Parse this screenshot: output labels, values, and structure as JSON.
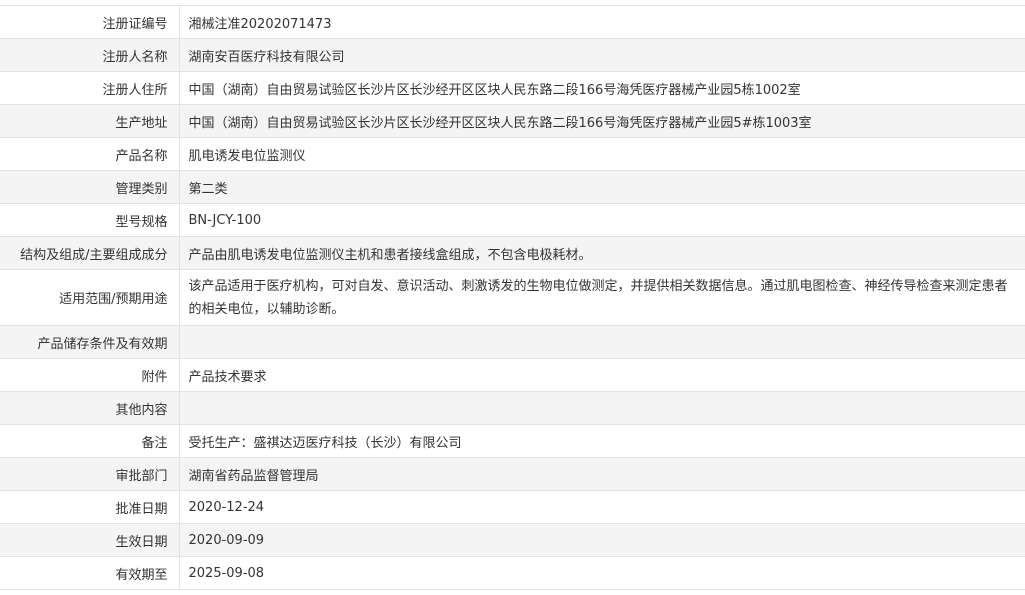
{
  "rows": [
    {
      "label": "注册证编号",
      "value": "湘械注准20202071473"
    },
    {
      "label": "注册人名称",
      "value": "湖南安百医疗科技有限公司"
    },
    {
      "label": "注册人住所",
      "value": "中国（湖南）自由贸易试验区长沙片区长沙经开区区块人民东路二段166号海凭医疗器械产业园5栋1002室"
    },
    {
      "label": "生产地址",
      "value": "中国（湖南）自由贸易试验区长沙片区长沙经开区区块人民东路二段166号海凭医疗器械产业园5#栋1003室"
    },
    {
      "label": "产品名称",
      "value": "肌电诱发电位监测仪"
    },
    {
      "label": "管理类别",
      "value": "第二类"
    },
    {
      "label": "型号规格",
      "value": "BN-JCY-100"
    },
    {
      "label": "结构及组成/主要组成成分",
      "value": "产品由肌电诱发电位监测仪主机和患者接线盒组成，不包含电极耗材。"
    },
    {
      "label": "适用范围/预期用途",
      "value": "该产品适用于医疗机构，可对自发、意识活动、刺激诱发的生物电位做测定，并提供相关数据信息。通过肌电图检查、神经传导检查来测定患者的相关电位，以辅助诊断。"
    },
    {
      "label": "产品储存条件及有效期",
      "value": ""
    },
    {
      "label": "附件",
      "value": "产品技术要求"
    },
    {
      "label": "其他内容",
      "value": ""
    },
    {
      "label": "备注",
      "value": "受托生产：盛祺达迈医疗科技（长沙）有限公司"
    },
    {
      "label": "审批部门",
      "value": "湖南省药品监督管理局"
    },
    {
      "label": "批准日期",
      "value": "2020-12-24"
    },
    {
      "label": "生效日期",
      "value": "2020-09-09"
    },
    {
      "label": "有效期至",
      "value": "2025-09-08"
    }
  ]
}
